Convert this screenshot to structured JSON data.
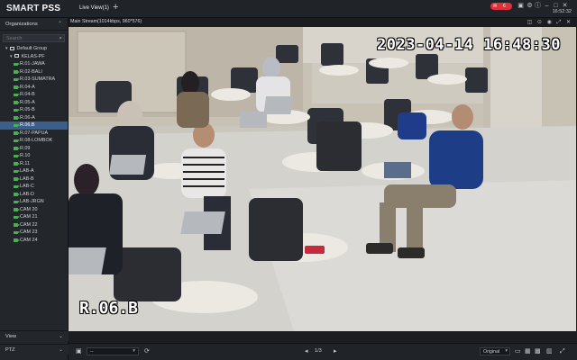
{
  "app": {
    "logo_prefix": "SMART ",
    "logo_bold": "PSS"
  },
  "tabs": [
    {
      "label": "Live View(1)"
    }
  ],
  "header": {
    "rec_label": "6",
    "time": "16:52:32"
  },
  "sidebar": {
    "section_title": "Organizations",
    "search_placeholder": "Search",
    "tree": {
      "root": "Default Group",
      "group": "KELAS-PF",
      "channels": [
        "R.01-JAWA",
        "R.02-BALI",
        "R.03-SUMATRA",
        "R.04-A",
        "R.04-B",
        "R.05-A",
        "R.05-B",
        "R.06-A",
        "R.06.B",
        "R.07-PAPUA",
        "R.08-LOMBOK",
        "R.09",
        "R.10",
        "R.11",
        "LAB-A",
        "LAB-B",
        "LAB-C",
        "LAB-D",
        "LAB-JRGN",
        "CAM 20",
        "CAM 21",
        "CAM 22",
        "CAM 23",
        "CAM 24"
      ],
      "selected_index": 8
    },
    "view_label": "View",
    "ptz_label": "PTZ"
  },
  "video": {
    "stream_info": "Main Stream(1014kbps, 960*576)",
    "osd_timestamp": "2023-04-14  16:48:30",
    "osd_channel": "R.06.B"
  },
  "toolbar": {
    "layout_value": "--",
    "page_indicator": "1/3",
    "ratio_value": "Original"
  },
  "colors": {
    "accent": "#3a5f8a",
    "online_camera": "#42b44a",
    "record": "#e0303a"
  }
}
